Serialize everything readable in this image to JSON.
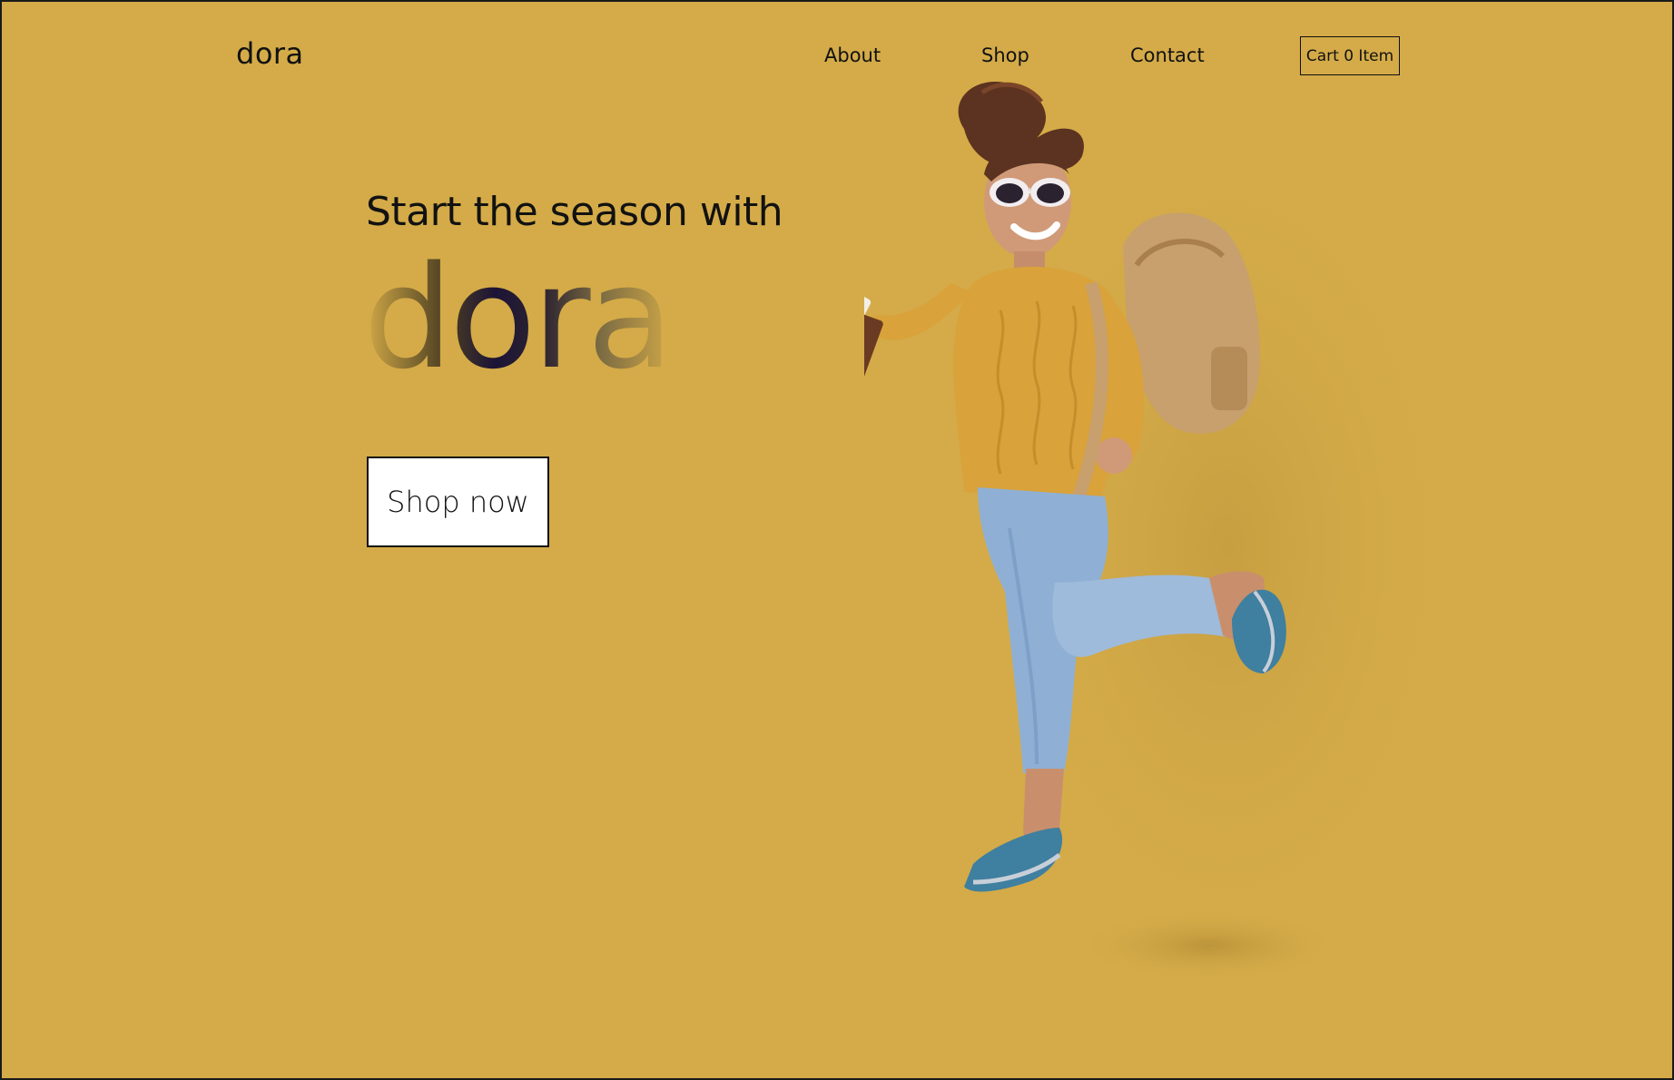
{
  "header": {
    "brand": "dora",
    "nav": {
      "about": "About",
      "shop": "Shop",
      "contact": "Contact"
    },
    "cart_label": "Cart 0 Item"
  },
  "hero": {
    "tagline": "Start the season with",
    "brand_display": "dora",
    "cta_label": "Shop now"
  },
  "colors": {
    "background": "#d4ab48",
    "text": "#111111",
    "button_bg": "#ffffff"
  }
}
